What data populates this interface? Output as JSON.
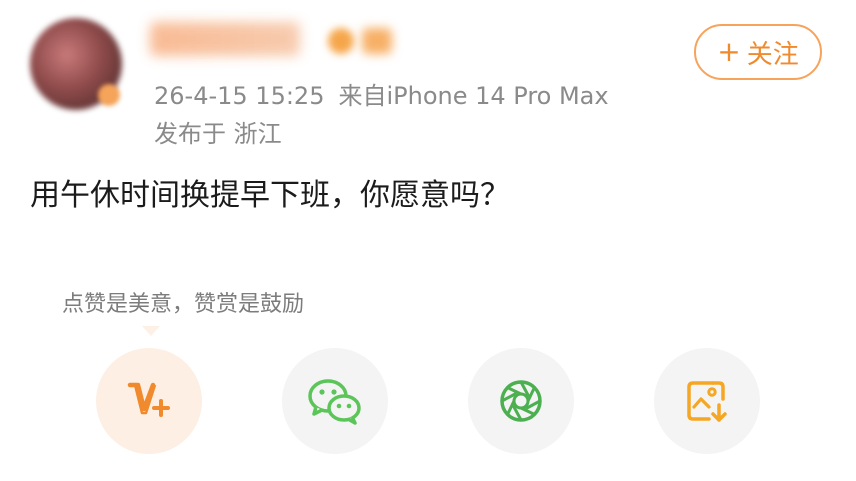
{
  "post": {
    "timestamp": "26-4-15 15:25",
    "source": "来自iPhone 14 Pro Max",
    "location": "发布于 浙江",
    "text": "用午休时间换提早下班，你愿意吗？"
  },
  "follow_button": {
    "plus": "+",
    "label": "关注"
  },
  "share_panel": {
    "hint": "点赞是美意，赞赏是鼓励",
    "actions": [
      {
        "icon": "weibo-vplus-icon",
        "color": "#f08a2c"
      },
      {
        "icon": "wechat-icon",
        "color": "#5cc55a"
      },
      {
        "icon": "moments-icon",
        "color": "#4caf50"
      },
      {
        "icon": "save-image-icon",
        "color": "#f5a623"
      }
    ]
  },
  "colors": {
    "accent": "#f08a2c",
    "meta_text": "#8a8a8a",
    "icon_bg": "#f4f4f4",
    "reward_bg": "#fdefe3"
  }
}
